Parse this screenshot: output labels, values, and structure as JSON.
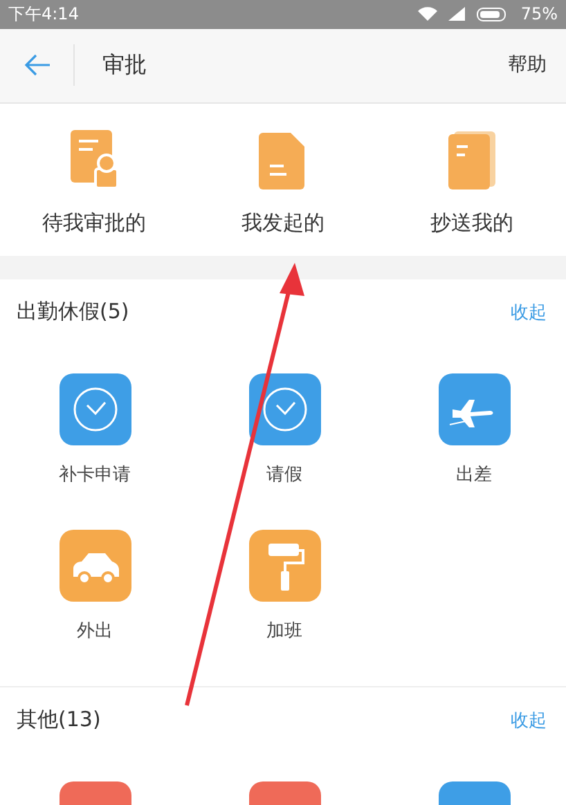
{
  "status_bar": {
    "time": "下午4:14",
    "battery": "75%"
  },
  "header": {
    "title": "审批",
    "action": "帮助"
  },
  "shortcuts": [
    {
      "label": "待我审批的",
      "kind": "stamp"
    },
    {
      "label": "我发起的",
      "kind": "doc"
    },
    {
      "label": "抄送我的",
      "kind": "docs"
    }
  ],
  "sections": [
    {
      "title": "出勤休假(5)",
      "toggle": "收起",
      "items": [
        {
          "label": "补卡申请",
          "kind": "clock",
          "color": "#3e9ee6"
        },
        {
          "label": "请假",
          "kind": "clock",
          "color": "#3e9ee6"
        },
        {
          "label": "出差",
          "kind": "plane",
          "color": "#3e9ee6"
        },
        {
          "label": "外出",
          "kind": "car",
          "color": "#f5a94b"
        },
        {
          "label": "加班",
          "kind": "roller",
          "color": "#f5a94b"
        }
      ]
    },
    {
      "title": "其他(13)",
      "toggle": "收起",
      "items": [
        {
          "kind": "cut",
          "color": "#ef6a58"
        },
        {
          "kind": "cut",
          "color": "#ef6a58"
        },
        {
          "kind": "cut",
          "color": "#3e9ee6"
        }
      ]
    }
  ]
}
